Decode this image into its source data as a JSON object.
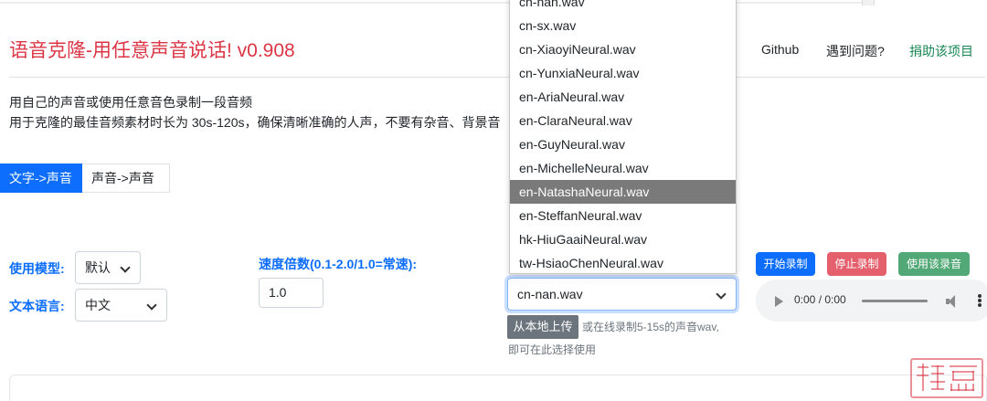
{
  "header": {
    "title": "语音克隆-用任意声音说话! v0.908",
    "nav": [
      "Github",
      "遇到问题?",
      "捐助该项目"
    ]
  },
  "description": {
    "line1": "用自己的声音或使用任意音色录制一段音频",
    "line2": "用于克隆的最佳音频素材时长为 30s-120s，确保清晰准确的人声，不要有杂音、背景音"
  },
  "tabs": [
    "文字->声音",
    "声音->声音"
  ],
  "form": {
    "model_label": "使用模型:",
    "model_value": "默认",
    "language_label": "文本语言:",
    "language_value": "中文",
    "speed_label": "速度倍数(0.1-2.0/1.0=常速):",
    "speed_value": "1.0",
    "voice_value": "cn-nan.wav",
    "upload_label": "从本地上传",
    "upload_hint_1": "或在线录制5-15s的声音wav,",
    "upload_hint_2": "即可在此选择使用"
  },
  "record": {
    "start": "开始录制",
    "stop": "停止录制",
    "use": "使用该录音",
    "time": "0:00 / 0:00"
  },
  "dropdown": {
    "options": [
      "cn-nan.wav",
      "cn-sx.wav",
      "cn-XiaoyiNeural.wav",
      "cn-YunxiaNeural.wav",
      "en-AriaNeural.wav",
      "en-ClaraNeural.wav",
      "en-GuyNeural.wav",
      "en-MichelleNeural.wav",
      "en-NatashaNeural.wav",
      "en-SteffanNeural.wav",
      "hk-HiuGaaiNeural.wav",
      "tw-HsiaoChenNeural.wav"
    ],
    "highlighted": "en-NatashaNeural.wav"
  },
  "colors": {
    "title_red": "#dc3545",
    "primary_blue": "#0d6efd",
    "success_green": "#198754",
    "stop_red": "#e4606d",
    "use_green": "#52a876"
  },
  "icons": [
    "chevron-down-icon",
    "play-icon",
    "volume-icon",
    "more-vertical-icon"
  ]
}
